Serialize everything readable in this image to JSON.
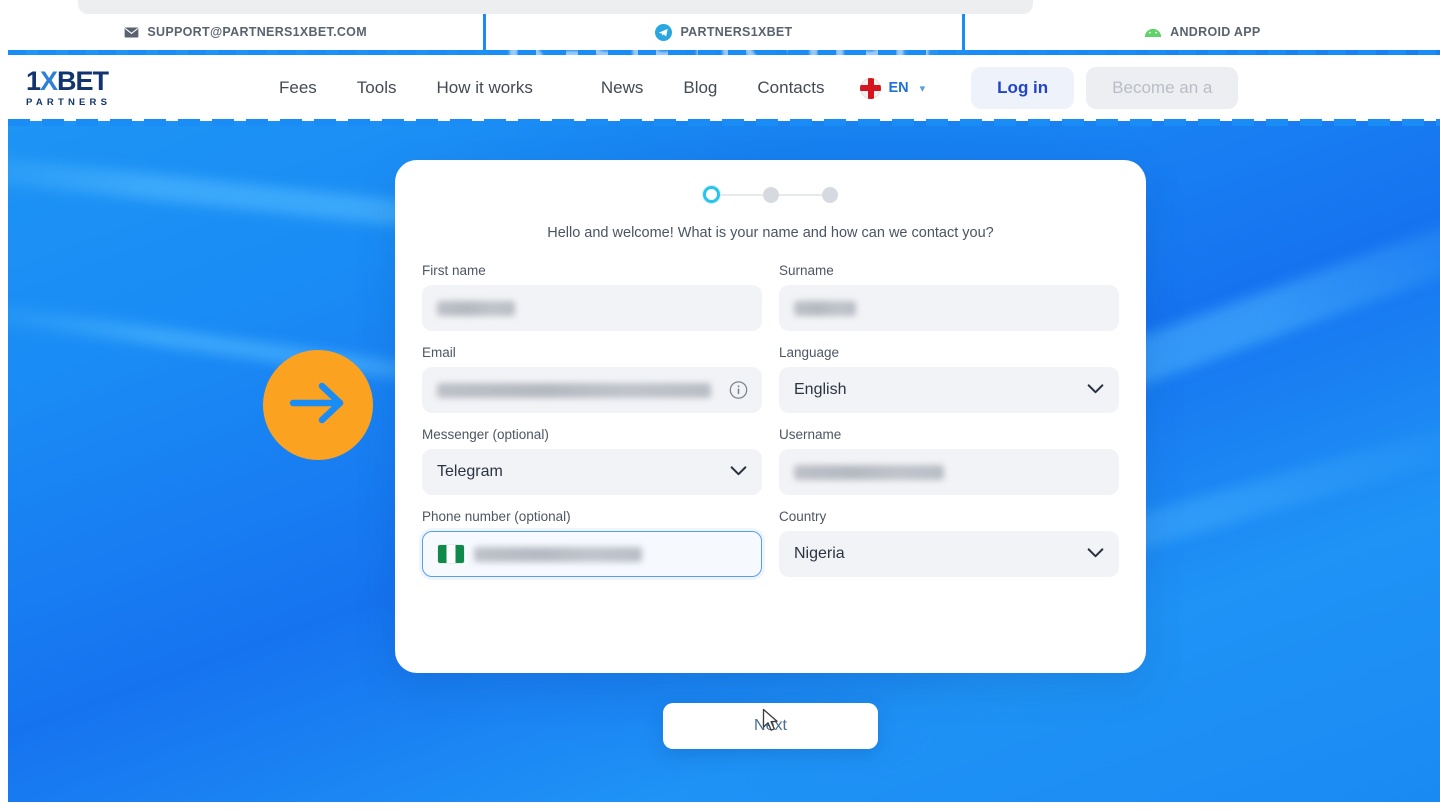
{
  "topbar": {
    "items": [
      {
        "icon": "envelope-icon",
        "label": "SUPPORT@PARTNERS1XBET.COM"
      },
      {
        "icon": "telegram-icon",
        "label": "PARTNERS1XBET"
      },
      {
        "icon": "android-icon",
        "label": "ANDROID APP"
      }
    ]
  },
  "nav": {
    "logo": {
      "main_1": "1",
      "main_x": "X",
      "main_2": "BET",
      "sub": "PARTNERS"
    },
    "links_left": [
      "Fees",
      "Tools",
      "How it works"
    ],
    "links_right": [
      "News",
      "Blog",
      "Contacts"
    ],
    "language": {
      "code": "EN",
      "flag": "england-flag-icon"
    },
    "login_label": "Log in",
    "become_label": "Become an a"
  },
  "hero": {
    "ghost_heading": "REGISTRATION"
  },
  "card": {
    "steps": {
      "total": 3,
      "active_index": 0
    },
    "intro": "Hello and welcome! What is your name and how can we contact you?",
    "fields": [
      {
        "name": "first-name",
        "label": "First name",
        "type": "text",
        "value": "",
        "redacted": true,
        "redact_width": 78,
        "focused": false
      },
      {
        "name": "surname",
        "label": "Surname",
        "type": "text",
        "value": "",
        "redacted": true,
        "redact_width": 62,
        "focused": false
      },
      {
        "name": "email",
        "label": "Email",
        "type": "text",
        "value": "",
        "redacted": true,
        "redact_width": 274,
        "focused": false,
        "trailing_icon": "info-icon"
      },
      {
        "name": "language",
        "label": "Language",
        "type": "select",
        "value": "English",
        "redacted": false,
        "focused": false
      },
      {
        "name": "messenger",
        "label": "Messenger (optional)",
        "type": "select",
        "value": "Telegram",
        "redacted": false,
        "focused": false
      },
      {
        "name": "username",
        "label": "Username",
        "type": "text",
        "value": "",
        "redacted": true,
        "redact_width": 150,
        "focused": false
      },
      {
        "name": "phone",
        "label": "Phone number (optional)",
        "type": "tel",
        "value": "",
        "redacted": true,
        "redact_width": 168,
        "focused": true,
        "leading_icon": "nigeria-flag-icon"
      },
      {
        "name": "country",
        "label": "Country",
        "type": "select",
        "value": "Nigeria",
        "redacted": false,
        "focused": false
      }
    ]
  },
  "actions": {
    "next_label": "Next"
  },
  "annotation": {
    "arrow": "right-arrow-icon"
  },
  "colors": {
    "brand_blue": "#1a8cf5",
    "accent_orange": "#fba321",
    "step_active": "#29c3ec",
    "login_text": "#2344c7",
    "field_bg": "#f2f3f6",
    "focus_border": "#5a9fe6"
  }
}
